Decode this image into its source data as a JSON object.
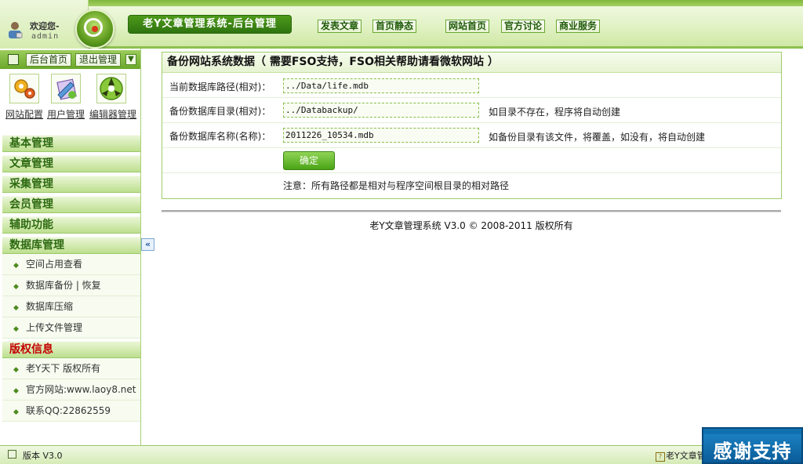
{
  "header": {
    "welcome": "欢迎您-",
    "username": "admin",
    "system_title": "老Y文章管理系统-后台管理",
    "nav": [
      "发表文章",
      "首页静态",
      "网站首页",
      "官方讨论",
      "商业服务"
    ]
  },
  "sidebar": {
    "toolbar": {
      "home": "后台首页",
      "logout": "退出管理"
    },
    "quick_links": [
      "网站配置",
      "用户管理",
      "编辑器管理"
    ],
    "menus": [
      "基本管理",
      "文章管理",
      "采集管理",
      "会员管理",
      "辅助功能",
      "数据库管理"
    ],
    "db_items": [
      "空间占用查看",
      "数据库备份 | 恢复",
      "数据库压缩",
      "上传文件管理"
    ],
    "copyright_head": "版权信息",
    "copyright_items": [
      "老Y天下 版权所有",
      "官方网站:www.laoy8.net",
      "联系QQ:22862559"
    ]
  },
  "panel": {
    "title": "备份网站系统数据（ 需要FSO支持，FSO相关帮助请看微软网站 ）",
    "rows": [
      {
        "label": "当前数据库路径(相对)：",
        "value": "../Data/life.mdb",
        "hint": ""
      },
      {
        "label": "备份数据库目录(相对)：",
        "value": "../Databackup/",
        "hint": "如目录不存在，程序将自动创建"
      },
      {
        "label": "备份数据库名称(名称)：",
        "value": "2011226_10534.mdb",
        "hint": "如备份目录有该文件，将覆盖，如没有，将自动创建"
      }
    ],
    "submit": "确定",
    "note": "注意：所有路径都是相对与程序空间根目录的相对路径"
  },
  "footer": {
    "copyright": "老Y文章管理系统 V3.0 © 2008-2011 版权所有"
  },
  "statusbar": {
    "version": "版本 V3.0",
    "right_text": "老Y文章管理系统"
  },
  "thanks": "感谢支持",
  "colors": {
    "accent_green": "#2f7410",
    "menu_green": "#2d6a10",
    "copyright_red": "#c40000"
  }
}
